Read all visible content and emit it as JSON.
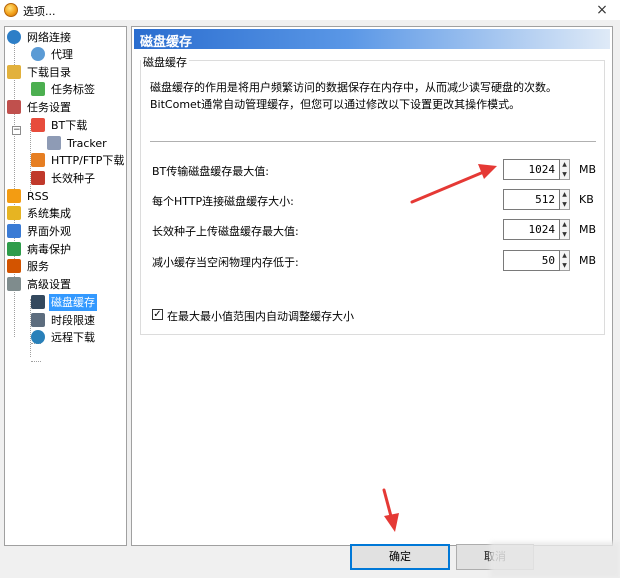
{
  "window": {
    "title": "选项..."
  },
  "tree": {
    "items": [
      {
        "label": "网络连接",
        "icon": "globe-network-icon",
        "color": "#2d7ec7"
      },
      {
        "label": "代理",
        "icon": "proxy-globe-icon",
        "color": "#5b9bd5"
      },
      {
        "label": "下载目录",
        "icon": "folder-open-icon",
        "color": "#e2b13c"
      },
      {
        "label": "任务标签",
        "icon": "tag-icon",
        "color": "#4caf50"
      },
      {
        "label": "任务设置",
        "icon": "task-settings-icon",
        "color": "#c0504d"
      },
      {
        "label": "BT下载",
        "icon": "bt-download-icon",
        "color": "#e74c3c"
      },
      {
        "label": "Tracker",
        "icon": "tracker-cube-icon",
        "color": "#8e9bb5"
      },
      {
        "label": "HTTP/FTP下载",
        "icon": "http-ftp-icon",
        "color": "#e67e22"
      },
      {
        "label": "长效种子",
        "icon": "long-seed-icon",
        "color": "#c0392b"
      },
      {
        "label": "RSS",
        "icon": "rss-icon",
        "color": "#f39c12"
      },
      {
        "label": "系统集成",
        "icon": "system-integration-icon",
        "color": "#e6b422"
      },
      {
        "label": "界面外观",
        "icon": "appearance-icon",
        "color": "#3a7bd5"
      },
      {
        "label": "病毒保护",
        "icon": "virus-shield-icon",
        "color": "#2e9c4a"
      },
      {
        "label": "服务",
        "icon": "service-people-icon",
        "color": "#d35400"
      },
      {
        "label": "高级设置",
        "icon": "advanced-settings-icon",
        "color": "#7f8c8d"
      },
      {
        "label": "磁盘缓存",
        "icon": "disk-cache-icon",
        "color": "#34495e"
      },
      {
        "label": "时段限速",
        "icon": "speed-limit-icon",
        "color": "#5d6d7e"
      },
      {
        "label": "远程下载",
        "icon": "remote-download-icon",
        "color": "#2980b9"
      }
    ]
  },
  "panel": {
    "header": "磁盘缓存",
    "group_title": "磁盘缓存",
    "description": "磁盘缓存的作用是将用户频繁访问的数据保存在内存中，从而减少读写硬盘的次数。BitComet通常自动管理缓存，但您可以通过修改以下设置更改其操作模式。",
    "fields": [
      {
        "label": "BT传输磁盘缓存最大值:",
        "value": "1024",
        "unit": "MB"
      },
      {
        "label": "每个HTTP连接磁盘缓存大小:",
        "value": "512",
        "unit": "KB"
      },
      {
        "label": "长效种子上传磁盘缓存最大值:",
        "value": "1024",
        "unit": "MB"
      },
      {
        "label": "减小缓存当空闲物理内存低于:",
        "value": "50",
        "unit": "MB"
      }
    ],
    "checkbox": {
      "label": "在最大最小值范围内自动调整缓存大小",
      "checked": true,
      "mark": "✓"
    }
  },
  "buttons": {
    "ok": "确定",
    "cancel": "取消"
  },
  "colors": {
    "header_start": "#2a6dcf",
    "selection": "#3399ff",
    "arrow": "#e53935"
  }
}
